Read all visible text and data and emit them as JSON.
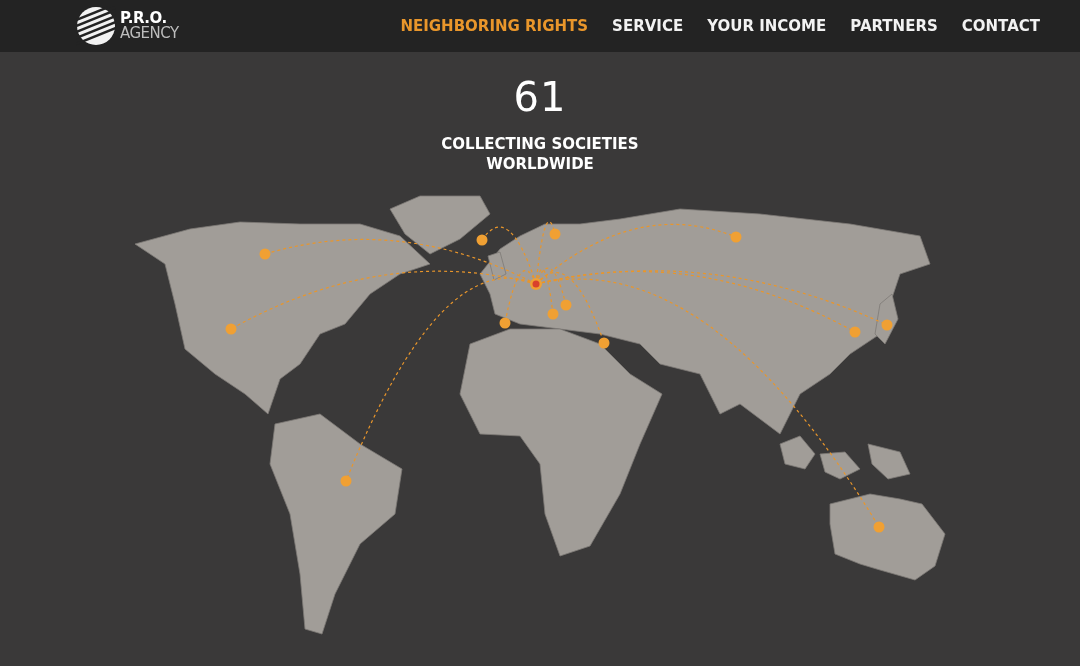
{
  "logo": {
    "title": "P.R.O.",
    "subtitle": "AGENCY"
  },
  "nav": [
    {
      "label": "NEIGHBORING RIGHTS",
      "selected": true
    },
    {
      "label": "SERVICE",
      "selected": false
    },
    {
      "label": "YOUR INCOME",
      "selected": false
    },
    {
      "label": "PARTNERS",
      "selected": false
    },
    {
      "label": "CONTACT",
      "selected": false
    }
  ],
  "stat": {
    "value": "61",
    "label": "COLLECTING SOCIETIES WORLDWIDE"
  }
}
